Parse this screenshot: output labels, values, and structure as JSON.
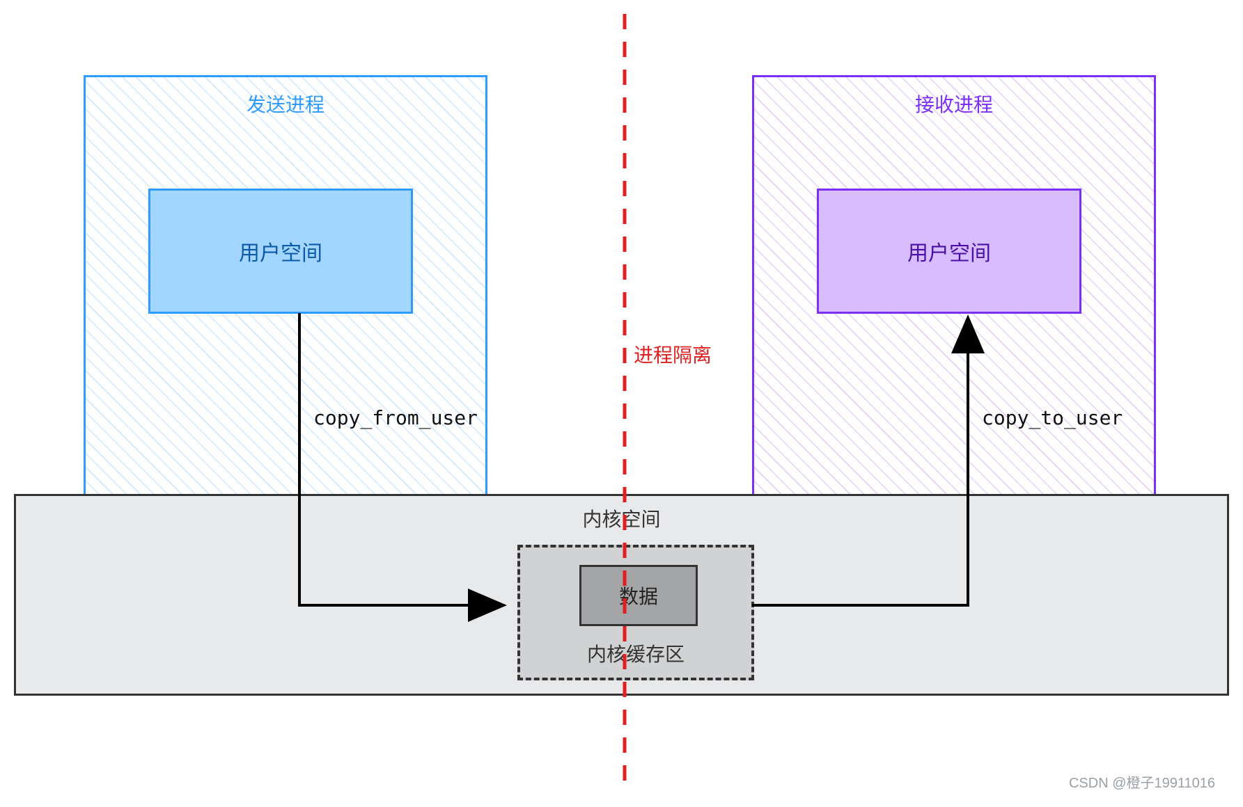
{
  "sender": {
    "title": "发送进程",
    "user_space": "用户空间",
    "arrow_label": "copy_from_user"
  },
  "receiver": {
    "title": "接收进程",
    "user_space": "用户空间",
    "arrow_label": "copy_to_user"
  },
  "kernel": {
    "title": "内核空间",
    "buffer_label": "内核缓存区",
    "data_label": "数据"
  },
  "divider_label": "进程隔离",
  "watermark": "CSDN @橙子19911016"
}
